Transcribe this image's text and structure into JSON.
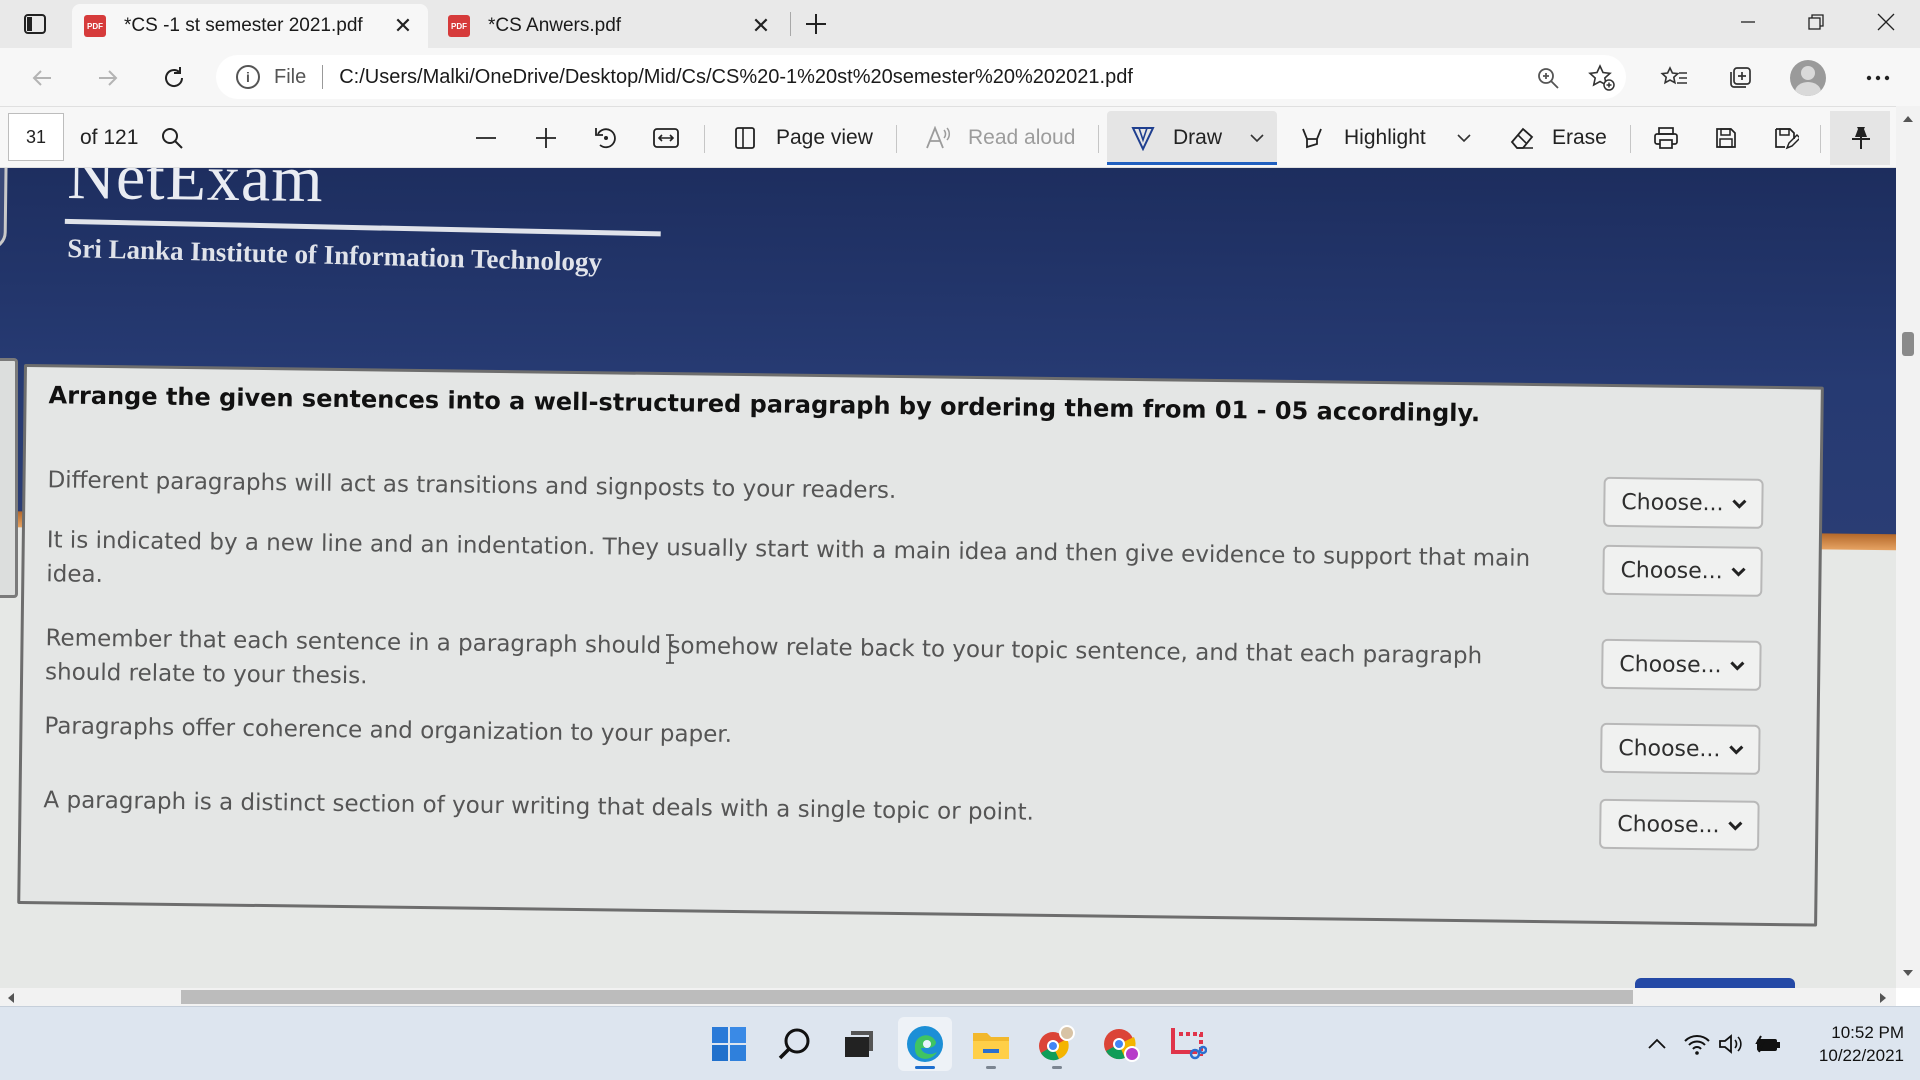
{
  "browser": {
    "tabs": [
      {
        "title": "*CS -1 st semester 2021.pdf",
        "active": true
      },
      {
        "title": "*CS Anwers.pdf",
        "active": false
      }
    ],
    "address": {
      "scheme": "File",
      "url": "C:/Users/Malki/OneDrive/Desktop/Mid/Cs/CS%20-1%20st%20semester%20%202021.pdf"
    }
  },
  "pdf_toolbar": {
    "page_number": "31",
    "page_total": "of 121",
    "page_view": "Page view",
    "read_aloud": "Read aloud",
    "draw": "Draw",
    "highlight": "Highlight",
    "erase": "Erase"
  },
  "document": {
    "brand": "NetExam",
    "institute": "Sri Lanka Institute of Information Technology",
    "question": "Arrange the given sentences into a well-structured paragraph by ordering them from 01 - 05 accordingly.",
    "sentences": [
      {
        "text": "Different paragraphs will act as transitions and signposts to your readers.",
        "select": "Choose..."
      },
      {
        "text": "It is indicated by a new line and an indentation. They usually start with a main idea and then give evidence to support that main idea.",
        "select": "Choose..."
      },
      {
        "text": "Remember that each sentence in a paragraph should somehow relate back to your topic sentence, and that each paragraph should relate to your thesis.",
        "select": "Choose..."
      },
      {
        "text": "Paragraphs offer coherence and organization to your paper.",
        "select": "Choose..."
      },
      {
        "text": "A paragraph is a distinct section of your writing that deals with a single topic or point.",
        "select": "Choose..."
      }
    ]
  },
  "taskbar": {
    "time": "10:52 PM",
    "date": "10/22/2021"
  },
  "colors": {
    "banner": "#263a72",
    "accent_stripe": "#d38a2c",
    "draw_underline": "#1f5fbf"
  }
}
